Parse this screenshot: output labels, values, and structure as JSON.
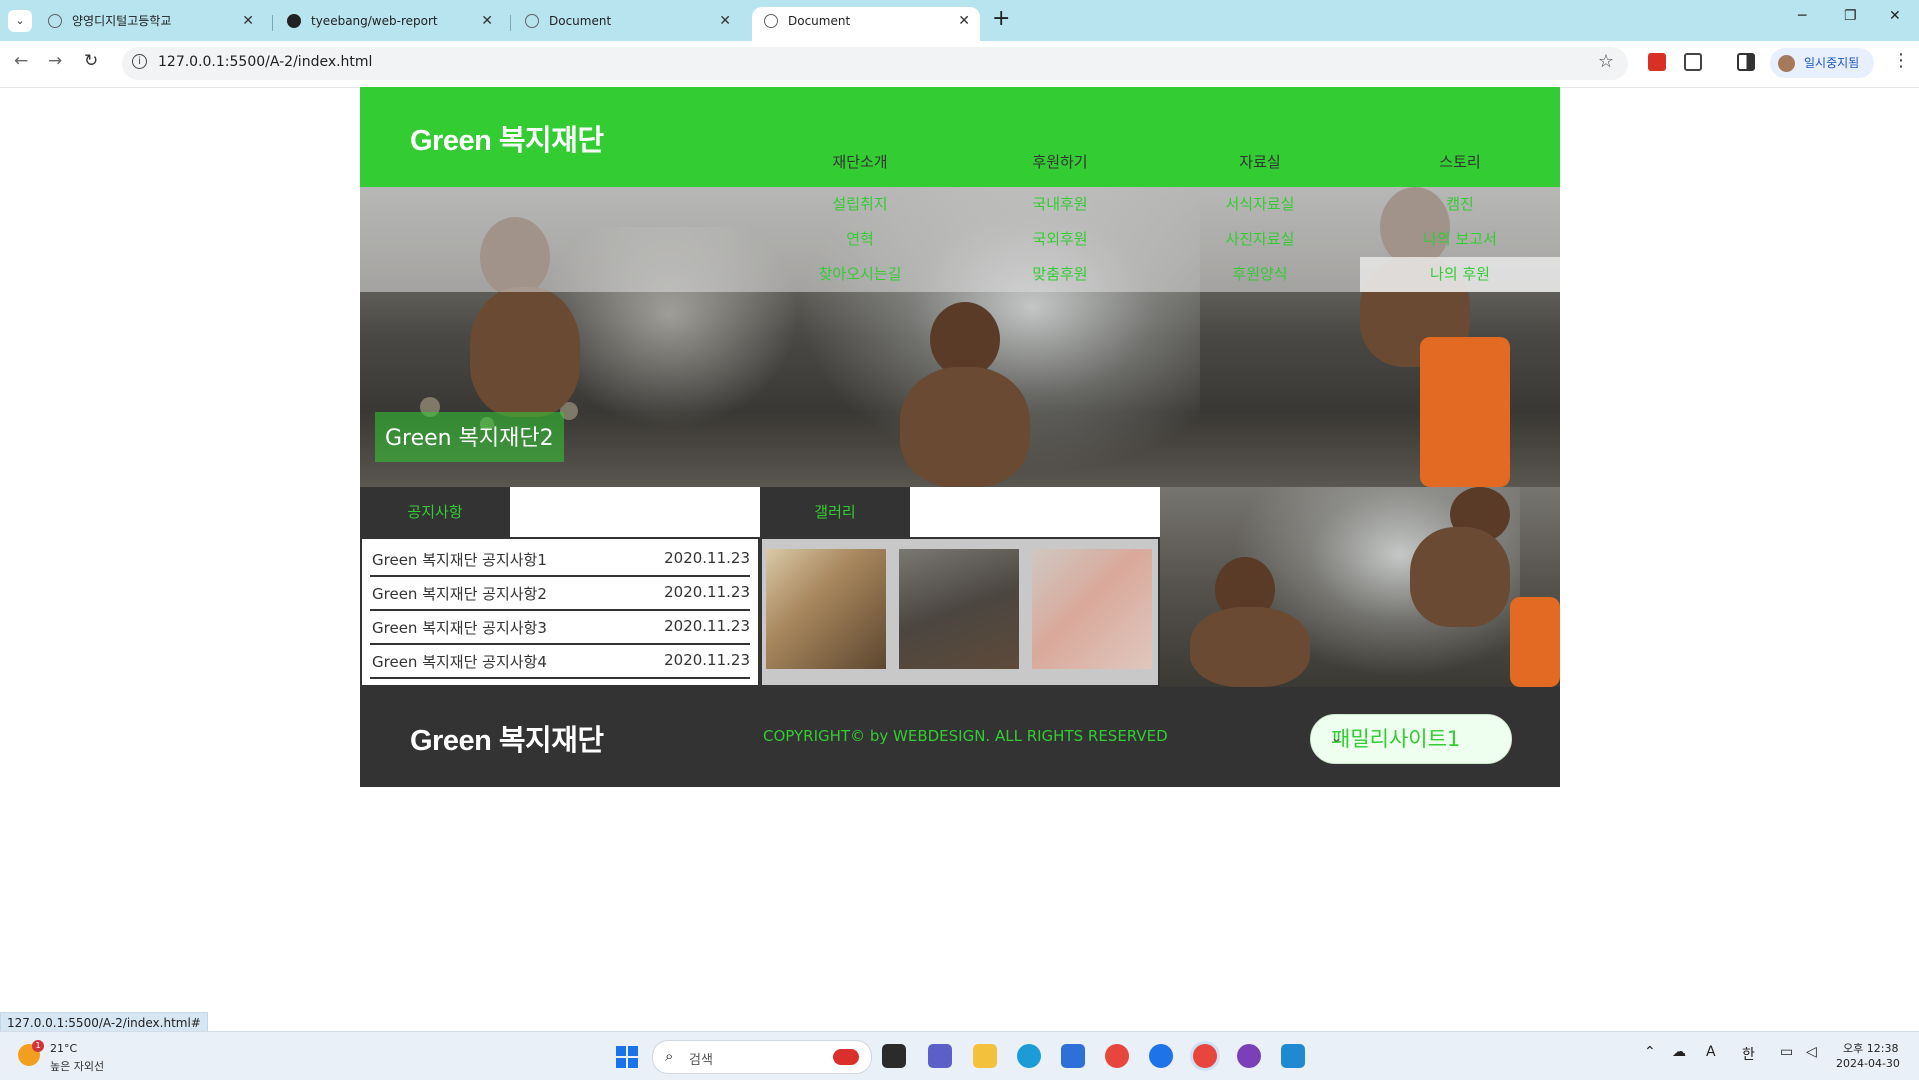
{
  "browser": {
    "tabs": [
      {
        "title": "양영디지털고등학교",
        "active": false
      },
      {
        "title": "tyeebang/web-report",
        "active": false
      },
      {
        "title": "Document",
        "active": false
      },
      {
        "title": "Document",
        "active": true
      }
    ],
    "url": "127.0.0.1:5500/A-2/index.html",
    "profile_label": "일시중지됨",
    "status_url": "127.0.0.1:5500/A-2/index.html#"
  },
  "site": {
    "logo": "Green 복지재단",
    "nav": [
      {
        "label": "재단소개",
        "sub": [
          "설립취지",
          "연혁",
          "찾아오시는길"
        ]
      },
      {
        "label": "후원하기",
        "sub": [
          "국내후원",
          "국외후원",
          "맞춤후원"
        ]
      },
      {
        "label": "자료실",
        "sub": [
          "서식자료실",
          "사진자료실",
          "후원양식"
        ]
      },
      {
        "label": "스토리",
        "sub": [
          "캠진",
          "나의 보고서",
          "나의 후원"
        ]
      }
    ],
    "hero_caption": "Green 복지재단2",
    "notice": {
      "tab_label": "공지사항",
      "items": [
        {
          "title": "Green 복지재단 공지사항1",
          "date": "2020.11.23"
        },
        {
          "title": "Green 복지재단 공지사항2",
          "date": "2020.11.23"
        },
        {
          "title": "Green 복지재단 공지사항3",
          "date": "2020.11.23"
        },
        {
          "title": "Green 복지재단 공지사항4",
          "date": "2020.11.23"
        }
      ]
    },
    "gallery": {
      "tab_label": "갤러리"
    },
    "footer": {
      "logo": "Green 복지재단",
      "copyright": "COPYRIGHT© by WEBDESIGN. ALL RIGHTS RESERVED",
      "family_site": "패밀리사이트1"
    },
    "colors": {
      "brand_green": "#33cc33",
      "dark": "#333333"
    }
  },
  "taskbar": {
    "weather_temp": "21°C",
    "weather_desc": "높은 자외선",
    "weather_badge": "1",
    "search_label": "검색",
    "time": "오후 12:38",
    "date": "2024-04-30"
  }
}
